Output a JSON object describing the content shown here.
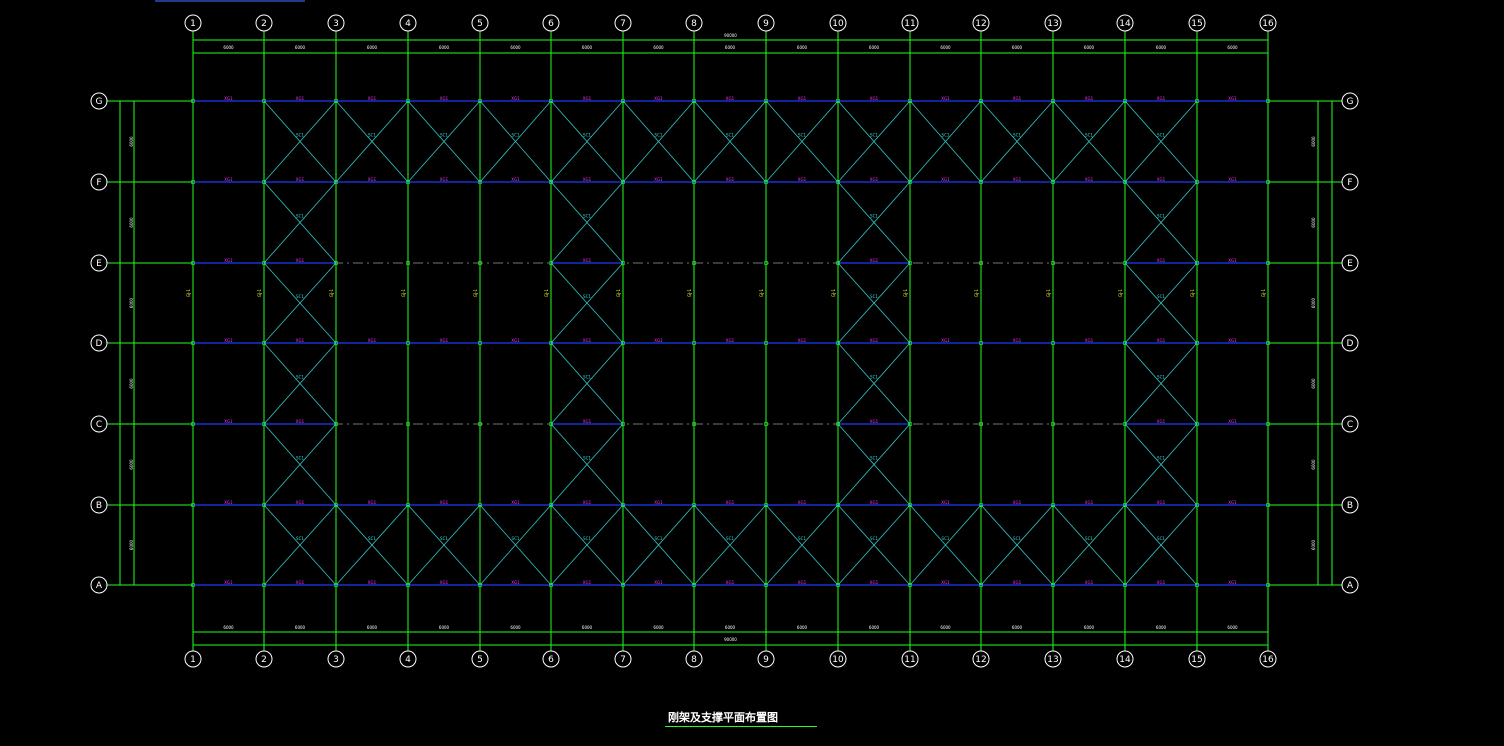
{
  "drawing": {
    "title": "刚架及支撑平面布置图",
    "colors": {
      "background": "#000000",
      "grid_line": "#22ff22",
      "purlin_blue": "#1f3bff",
      "brace_cyan": "#31c6c6",
      "label_magenta": "#ff33ff",
      "label_cyan": "#33dddd",
      "label_yellow": "#ffff33",
      "bubble": "#ffffff"
    },
    "column_axes": [
      "1",
      "2",
      "3",
      "4",
      "5",
      "6",
      "7",
      "8",
      "9",
      "10",
      "11",
      "12",
      "13",
      "14",
      "15",
      "16"
    ],
    "row_axes": [
      "G",
      "F",
      "E",
      "D",
      "C",
      "B",
      "A"
    ],
    "braced_bays_end": [
      1,
      13
    ],
    "braced_bays_mid": [
      5,
      9
    ],
    "roof_label": "XG1",
    "brace_label": "SC1",
    "column_label": "GJ-1"
  }
}
